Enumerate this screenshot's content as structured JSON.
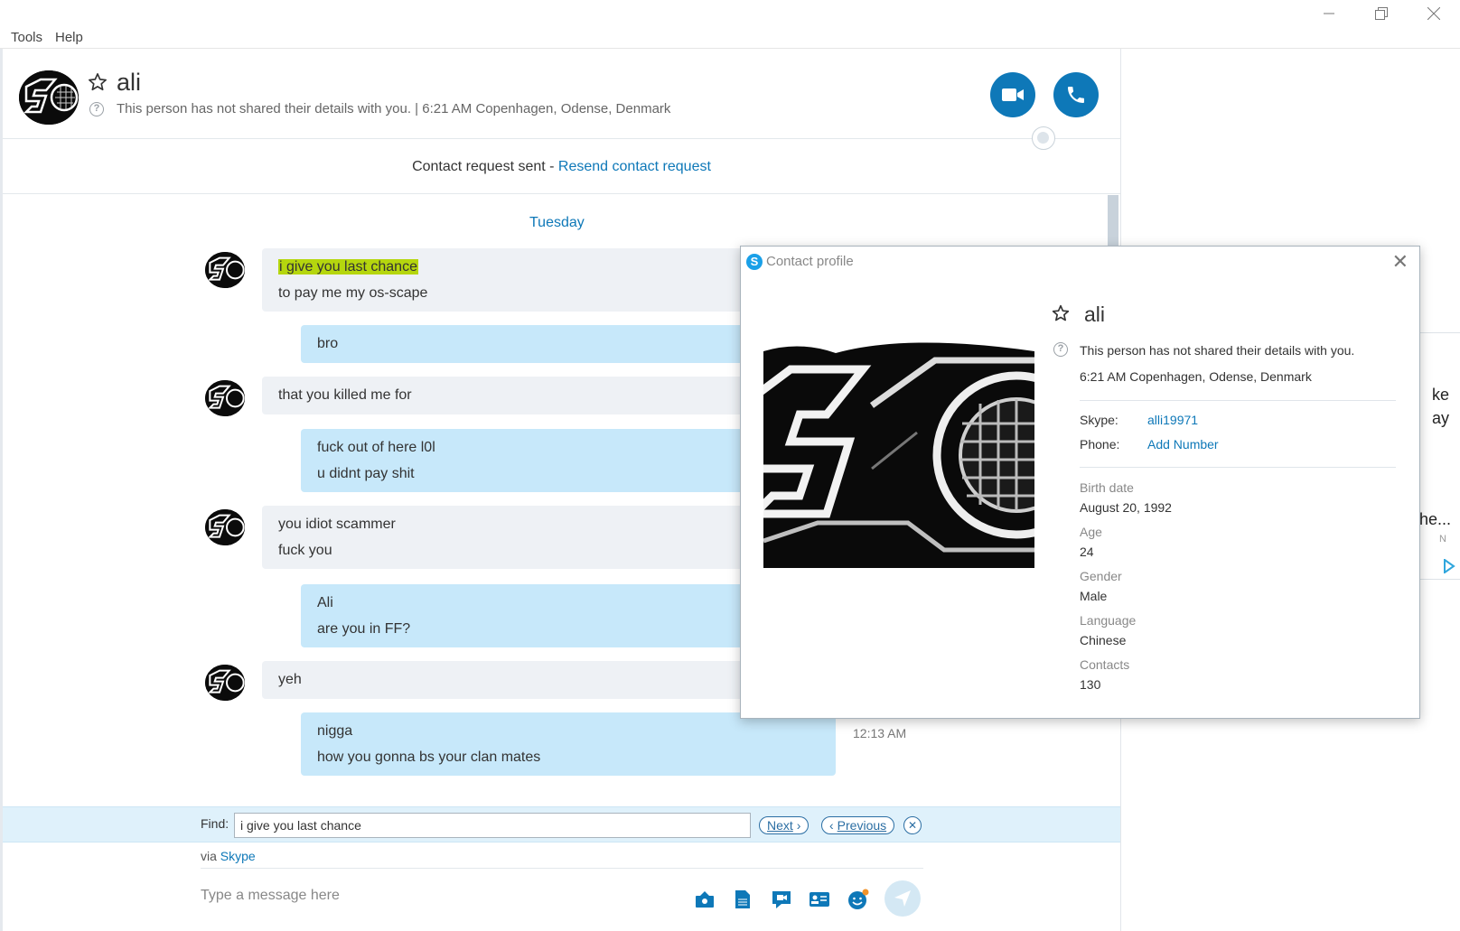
{
  "menu": {
    "tools": "Tools",
    "help": "Help"
  },
  "header": {
    "name": "ali",
    "status": "This person has not shared their details with you.  |  6:21 AM Copenhagen, Odense, Denmark"
  },
  "request_bar": {
    "text": "Contact request sent - ",
    "link": "Resend contact request"
  },
  "chat": {
    "day": "Tuesday",
    "messages": [
      {
        "dir": "in",
        "lines": [
          "i give you last chance",
          "to pay me my os-scape"
        ]
      },
      {
        "dir": "out",
        "lines": [
          "bro"
        ]
      },
      {
        "dir": "in",
        "lines": [
          "that you killed me for"
        ]
      },
      {
        "dir": "out",
        "lines": [
          "fuck out of here l0l",
          "u didnt pay shit"
        ]
      },
      {
        "dir": "in",
        "lines": [
          "you idiot scammer",
          "fuck you"
        ]
      },
      {
        "dir": "out",
        "lines": [
          "Ali",
          "are you in FF?"
        ]
      },
      {
        "dir": "in",
        "lines": [
          "yeh"
        ]
      },
      {
        "dir": "out",
        "lines": [
          "nigga",
          "how you gonna bs your clan mates"
        ],
        "time": "12:13 AM"
      }
    ]
  },
  "find": {
    "label": "Find:",
    "value": "i give you last chance",
    "next": "Next",
    "previous": "Previous"
  },
  "compose": {
    "via": "via",
    "via_link": "Skype",
    "placeholder": "Type a message here"
  },
  "ad": {
    "line1": "ke",
    "line2": "ay",
    "line3": "he...",
    "line4": "N"
  },
  "profile": {
    "title": "Contact profile",
    "name": "ali",
    "details_note": "This person has not shared their details with you.",
    "location": "6:21 AM Copenhagen, Odense, Denmark",
    "skype_label": "Skype:",
    "skype_value": "alli19971",
    "phone_label": "Phone:",
    "phone_value": "Add Number",
    "birth_label": "Birth date",
    "birth_value": "August 20, 1992",
    "age_label": "Age",
    "age_value": "24",
    "gender_label": "Gender",
    "gender_value": "Male",
    "language_label": "Language",
    "language_value": "Chinese",
    "contacts_label": "Contacts",
    "contacts_value": "130"
  },
  "colors": {
    "accent": "#0e78b8",
    "incoming": "#eef1f5",
    "outgoing": "#c7e8fa",
    "highlight": "#b5d60e"
  }
}
